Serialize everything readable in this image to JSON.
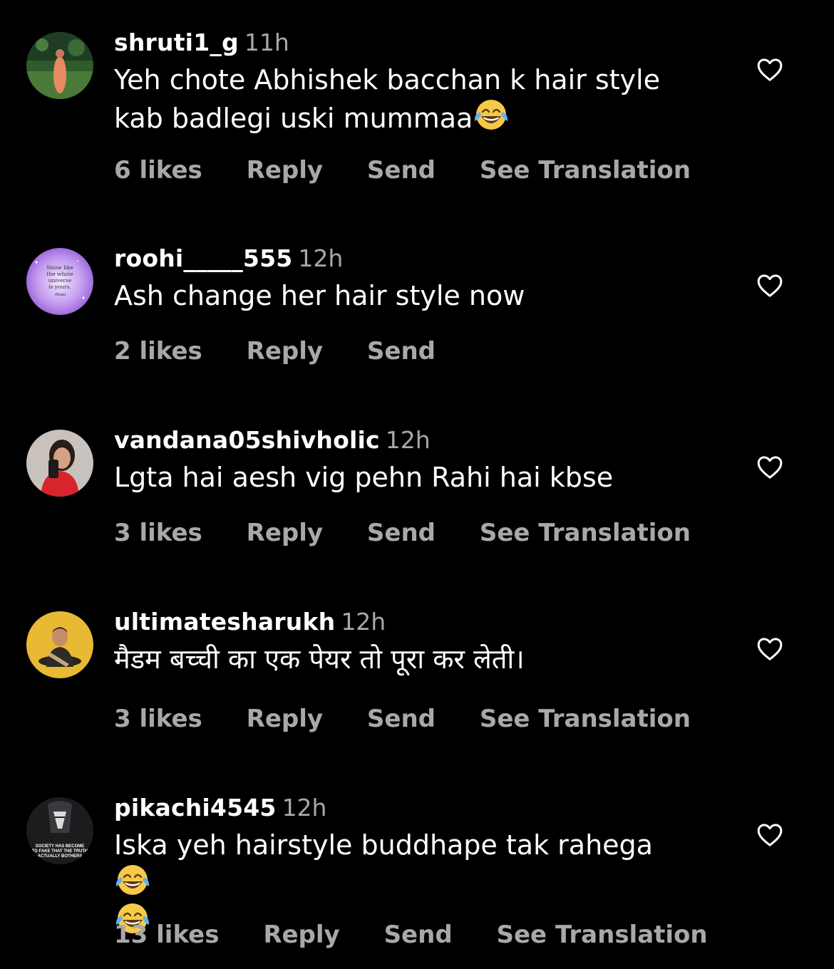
{
  "comments": [
    {
      "username": "shruti1_g",
      "time": "11h",
      "text": "Yeh chote Abhishek bacchan k hair style kab badlegi uski mummaa",
      "emoji": "face-with-tears-of-joy",
      "likes": "6 likes",
      "reply": "Reply",
      "send": "Send",
      "translate": "See Translation",
      "avatar": "landscape-photo"
    },
    {
      "username": "roohi_____555",
      "time": "12h",
      "text": "Ash change her hair style now",
      "likes": "2 likes",
      "reply": "Reply",
      "send": "Send",
      "avatar": "galaxy-quote",
      "avatar_text": [
        "Shine like",
        "the whole",
        "universe",
        "is yours.",
        "-Rumi"
      ]
    },
    {
      "username": "vandana05shivholic",
      "time": "12h",
      "text": "Lgta hai aesh vig pehn Rahi hai kbse",
      "likes": "3 likes",
      "reply": "Reply",
      "send": "Send",
      "translate": "See Translation",
      "avatar": "selfie-photo"
    },
    {
      "username": "ultimatesharukh",
      "time": "12h",
      "text": "मैडम बच्ची का एक पेयर तो पूरा कर लेती।",
      "likes": "3 likes",
      "reply": "Reply",
      "send": "Send",
      "translate": "See Translation",
      "avatar": "portrait-yellow"
    },
    {
      "username": "pikachi4545",
      "time": "12h",
      "text": "Iska yeh hairstyle buddhape tak rahega",
      "emoji": "face-with-tears-of-joy",
      "likes": "13 likes",
      "reply": "Reply",
      "send": "Send",
      "translate": "See Translation",
      "avatar": "dark-poster",
      "avatar_text": [
        "SOCIETY HAS BECOME",
        "TO FAKE THAT THE TRUTH",
        "ACTUALLY BOTHERS"
      ]
    }
  ],
  "colors": {
    "background": "#000000",
    "primary_text": "#ffffff",
    "secondary_text": "#a8a8a8"
  },
  "icons": {
    "like": "heart-outline-icon",
    "emoji": "face-with-tears-of-joy"
  }
}
